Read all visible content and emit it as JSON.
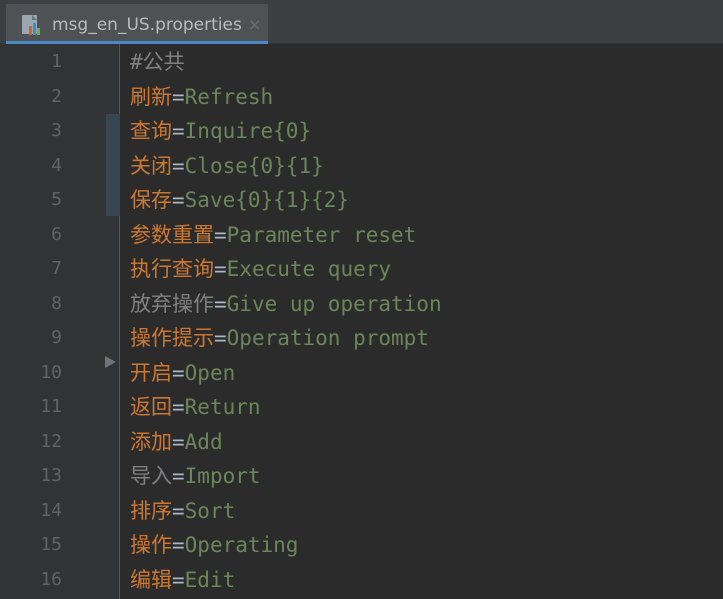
{
  "tab": {
    "filename": "msg_en_US.properties",
    "close_glyph": "×",
    "icon": "properties-file-icon"
  },
  "colors": {
    "key": "#cc7832",
    "key_unused": "#808080",
    "equals": "#a9b7c6",
    "value": "#6a8759",
    "comment": "#808080",
    "tab_underline": "#4a88c7"
  },
  "editor": {
    "lines": [
      {
        "num": "1",
        "comment": "#公共"
      },
      {
        "num": "2",
        "key": "刷新",
        "eq": "=",
        "value": "Refresh"
      },
      {
        "num": "3",
        "key": "查询",
        "eq": "=",
        "value": "Inquire{0}"
      },
      {
        "num": "4",
        "key": "关闭",
        "eq": "=",
        "value": "Close{0}{1}"
      },
      {
        "num": "5",
        "key": "保存",
        "eq": "=",
        "value": "Save{0}{1}{2}"
      },
      {
        "num": "6",
        "key": "参数重置",
        "eq": "=",
        "value": "Parameter reset"
      },
      {
        "num": "7",
        "key": "执行查询",
        "eq": "=",
        "value": "Execute query"
      },
      {
        "num": "8",
        "key": "放弃操作",
        "eq": "=",
        "value": "Give up operation",
        "unused": true
      },
      {
        "num": "9",
        "key": "操作提示",
        "eq": "=",
        "value": "Operation prompt"
      },
      {
        "num": "10",
        "key": "开启",
        "eq": "=",
        "value": "Open"
      },
      {
        "num": "11",
        "key": "返回",
        "eq": "=",
        "value": "Return"
      },
      {
        "num": "12",
        "key": "添加",
        "eq": "=",
        "value": "Add"
      },
      {
        "num": "13",
        "key": "导入",
        "eq": "=",
        "value": "Import",
        "unused": true
      },
      {
        "num": "14",
        "key": "排序",
        "eq": "=",
        "value": "Sort"
      },
      {
        "num": "15",
        "key": "操作",
        "eq": "=",
        "value": "Operating"
      },
      {
        "num": "16",
        "key": "编辑",
        "eq": "=",
        "value": "Edit"
      }
    ]
  }
}
